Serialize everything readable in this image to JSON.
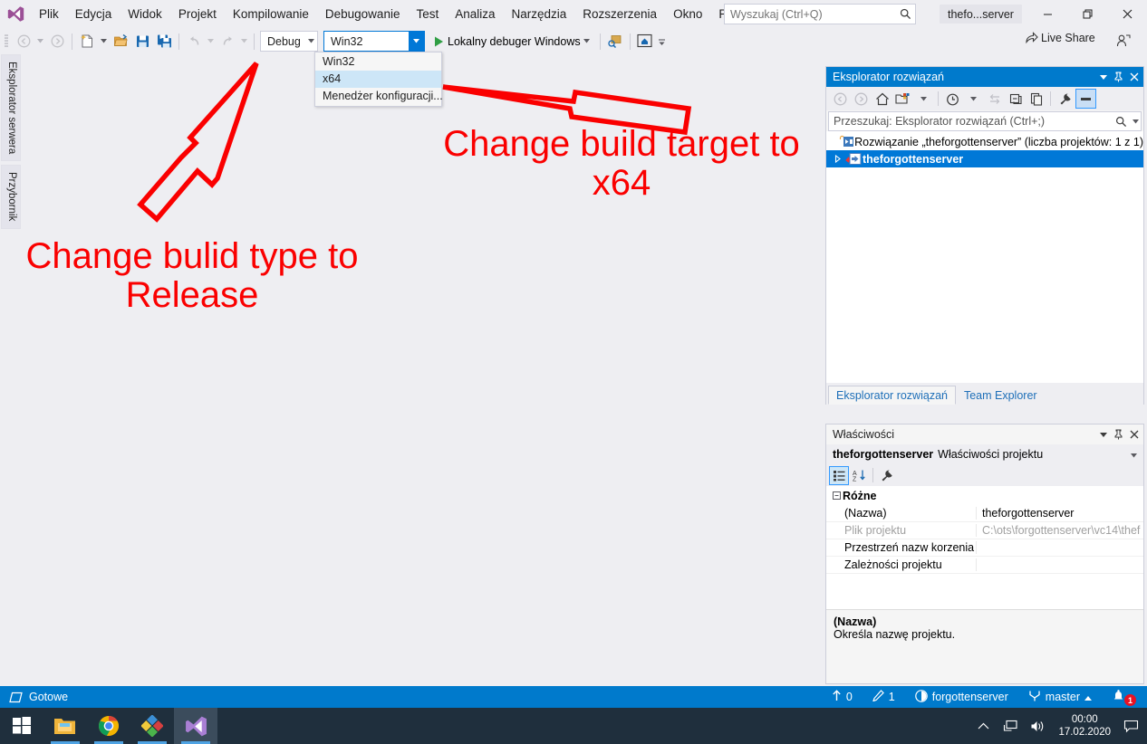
{
  "titlebar": {
    "menus": [
      "Plik",
      "Edycja",
      "Widok",
      "Projekt",
      "Kompilowanie",
      "Debugowanie",
      "Test",
      "Analiza",
      "Narzędzia",
      "Rozszerzenia",
      "Okno",
      "Pomoc"
    ],
    "search_placeholder": "Wyszukaj (Ctrl+Q)",
    "window_title": "thefo...server",
    "minimize": "—",
    "restore": "❐",
    "close": "✕"
  },
  "toolbar": {
    "config_value": "Debug",
    "platform_value": "Win32",
    "run_label": "Lokalny debuger Windows",
    "live_share_label": "Live Share"
  },
  "platform_dropdown": {
    "items": [
      "Win32",
      "x64",
      "Menedżer konfiguracji..."
    ],
    "selected": "x64"
  },
  "left_tabs": [
    "Eksplorator serwera",
    "Przybornik"
  ],
  "annotations": [
    {
      "id": "release",
      "text": "Change bulid type to Release",
      "color": "#fa0000"
    },
    {
      "id": "x64",
      "text": "Change build target to x64",
      "color": "#fa0000"
    }
  ],
  "solution_explorer": {
    "title": "Eksplorator rozwiązań",
    "search_placeholder": "Przeszukaj: Eksplorator rozwiązań (Ctrl+;)",
    "tree": [
      {
        "label": "Rozwiązanie „theforgottenserver” (liczba projektów: 1 z 1)",
        "selected": false,
        "expander": ""
      },
      {
        "label": "theforgottenserver",
        "selected": true,
        "expander": "▷"
      }
    ],
    "tabs": [
      {
        "label": "Eksplorator rozwiązań",
        "active": true
      },
      {
        "label": "Team Explorer",
        "active": false
      }
    ]
  },
  "properties": {
    "title": "Właściwości",
    "object_name": "theforgottenserver",
    "object_type": "Właściwości projektu",
    "category": "Różne",
    "rows": [
      {
        "key": "(Nazwa)",
        "value": "theforgottenserver",
        "dim": false
      },
      {
        "key": "Plik projektu",
        "value": "C:\\ots\\forgottenserver\\vc14\\thef",
        "dim": true
      },
      {
        "key": "Przestrzeń nazw korzenia",
        "value": "",
        "dim": false
      },
      {
        "key": "Zależności projektu",
        "value": "",
        "dim": false
      }
    ],
    "desc_title": "(Nazwa)",
    "desc_text": "Określa nazwę projektu."
  },
  "statusbar": {
    "status": "Gotowe",
    "outgoing_count": "0",
    "changes_count": "1",
    "repo": "forgottenserver",
    "branch": "master",
    "notification_count": "1"
  },
  "taskbar": {
    "items": [
      "start-button",
      "file-explorer",
      "google-chrome",
      "paint-net",
      "visual-studio"
    ],
    "time": "00:00",
    "date": "17.02.2020"
  },
  "colors": {
    "accent": "#007acc",
    "annotation": "#fa0000",
    "selection": "#0078d7",
    "taskbar": "#1f2f3d"
  }
}
